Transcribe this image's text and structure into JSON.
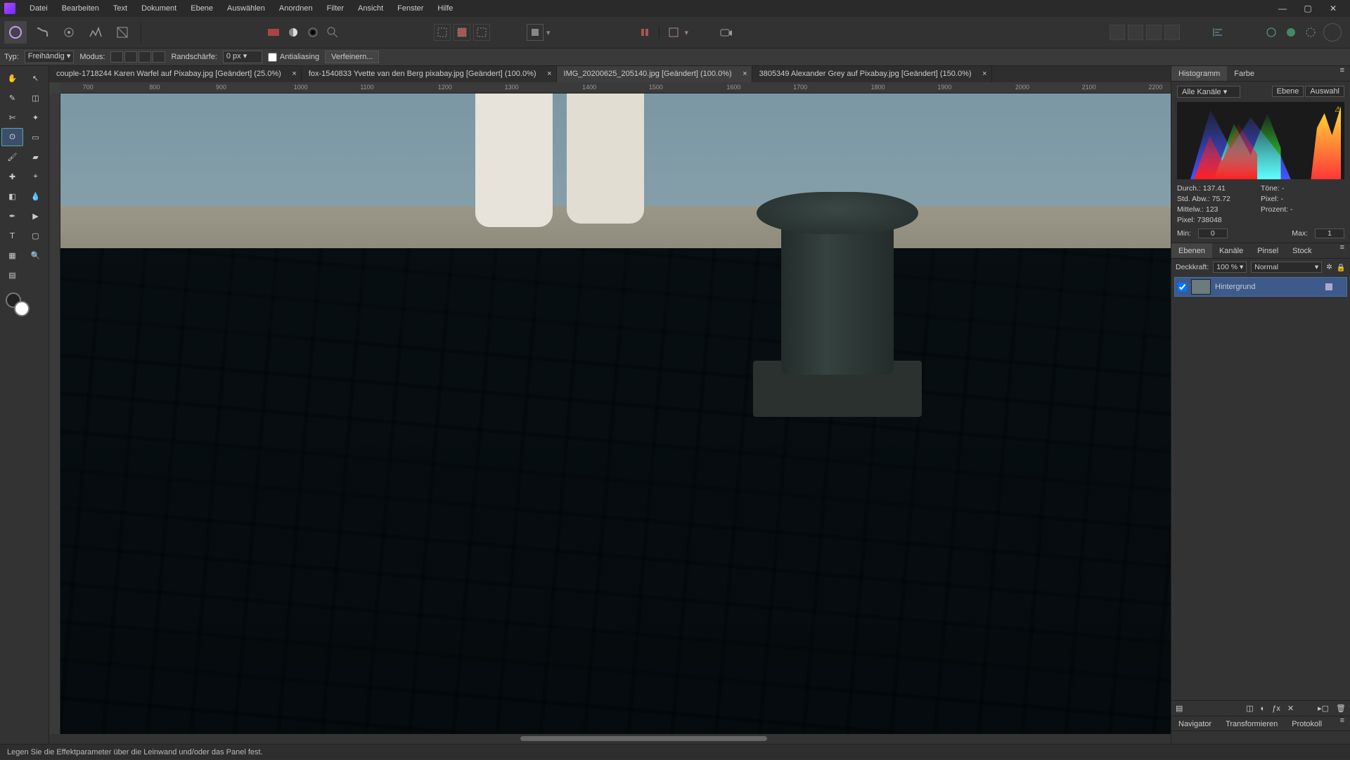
{
  "menu": {
    "items": [
      "Datei",
      "Bearbeiten",
      "Text",
      "Dokument",
      "Ebene",
      "Auswählen",
      "Anordnen",
      "Filter",
      "Ansicht",
      "Fenster",
      "Hilfe"
    ]
  },
  "ctx": {
    "typ_label": "Typ:",
    "typ_value": "Freihändig",
    "modus_label": "Modus:",
    "feather_label": "Randschärfe:",
    "feather_value": "0 px",
    "antialias_label": "Antialiasing",
    "refine_label": "Verfeinern..."
  },
  "tabs": [
    {
      "label": "couple-1718244 Karen Warfel auf Pixabay.jpg [Geändert] (25.0%)",
      "active": false
    },
    {
      "label": "fox-1540833 Yvette van den Berg pixabay.jpg [Geändert] (100.0%)",
      "active": false
    },
    {
      "label": "IMG_20200625_205140.jpg [Geändert] (100.0%)",
      "active": true
    },
    {
      "label": "3805349 Alexander Grey auf Pixabay.jpg [Geändert] (150.0%)",
      "active": false
    }
  ],
  "ruler_ticks": [
    "700",
    "800",
    "900",
    "1000",
    "1100",
    "1200",
    "1300",
    "1400",
    "1500",
    "1600",
    "1700",
    "1800",
    "1900",
    "2000",
    "2100",
    "2200"
  ],
  "panel_histo": {
    "tabs": [
      "Histogramm",
      "Farbe"
    ],
    "channel_label": "Alle Kanäle",
    "btn_ebene": "Ebene",
    "btn_auswahl": "Auswahl",
    "stats": {
      "mean_label": "Durch.:",
      "mean": "137.41",
      "std_label": "Std. Abw.:",
      "std": "75.72",
      "median_label": "Mittelw.:",
      "median": "123",
      "pixel_label": "Pixel:",
      "pixel": "738048",
      "tone_label": "Töne:",
      "tone": "-",
      "pix_label": "Pixel:",
      "pix": "-",
      "pct_label": "Prozent:",
      "pct": "-"
    },
    "min_label": "Min:",
    "min": "0",
    "max_label": "Max:",
    "max": "1"
  },
  "panel_layers": {
    "tabs": [
      "Ebenen",
      "Kanäle",
      "Pinsel",
      "Stock"
    ],
    "opacity_label": "Deckkraft:",
    "opacity_value": "100 %",
    "blend_value": "Normal",
    "layer0": "Hintergrund"
  },
  "panel_bottom": {
    "tabs": [
      "Navigator",
      "Transformieren",
      "Protokoll"
    ]
  },
  "status": "Legen Sie die Effektparameter über die Leinwand und/oder das Panel fest."
}
